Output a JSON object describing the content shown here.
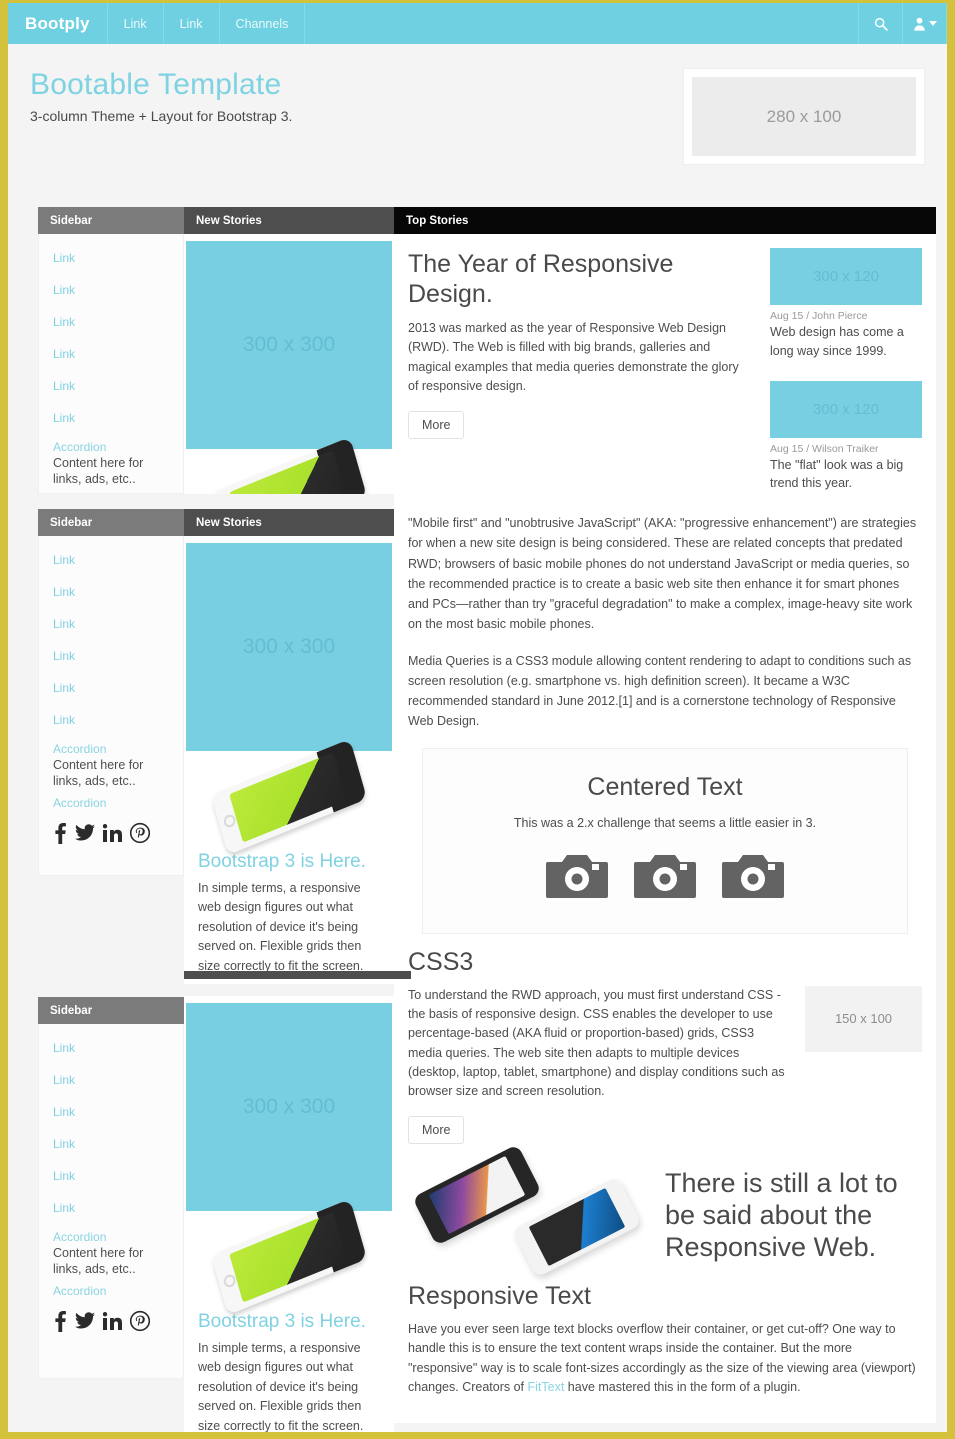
{
  "colors": {
    "brand": "#6ed0e0",
    "frame": "#d4c13c",
    "accent": "#7ed3e3",
    "placeholder_blue": "#79cfe2"
  },
  "navbar": {
    "brand": "Bootply",
    "links": [
      "Link",
      "Link",
      "Channels"
    ],
    "search_icon": "search-icon",
    "user_icon": "user-icon"
  },
  "hero": {
    "title": "Bootable Template",
    "subtitle": "3-column Theme + Layout for Bootstrap 3.",
    "ad_placeholder": "280 x 100"
  },
  "panels": {
    "sidebar_header": "Sidebar",
    "new_stories_header": "New Stories",
    "top_stories_header": "Top Stories"
  },
  "sidebar": {
    "links": [
      "Link",
      "Link",
      "Link",
      "Link",
      "Link",
      "Link"
    ],
    "accordion_title": "Accordion",
    "accordion_body": "Content here for links, ads, etc..",
    "accordion_title2": "Accordion",
    "social": [
      "facebook-icon",
      "twitter-icon",
      "linkedin-icon",
      "pinterest-icon"
    ]
  },
  "new_stories": {
    "image_placeholder": "300 x 300",
    "story_title": "Bootstrap 3 is Here.",
    "story_text": "In simple terms, a responsive web design figures out what resolution of device it's being served on. Flexible grids then size correctly to fit the screen."
  },
  "top_stories": {
    "article_title": "The Year of Responsive Design.",
    "article_text": "2013 was marked as the year of Responsive Web Design (RWD). The Web is filled with big brands, galleries and magical examples that media queries demonstrate the glory of responsive design.",
    "more_label": "More",
    "teasers": [
      {
        "placeholder": "300 x 120",
        "meta": "Aug 15 / John Pierce",
        "text": "Web design has come a long way since 1999."
      },
      {
        "placeholder": "300 x 120",
        "meta": "Aug 15 / Wilson Traiker",
        "text": "The \"flat\" look was a big trend this year."
      }
    ],
    "paragraphs": [
      "\"Mobile first\" and \"unobtrusive JavaScript\" (AKA: \"progressive enhancement\") are strategies for when a new site design is being considered. These are related concepts that predated RWD; browsers of basic mobile phones do not understand JavaScript or media queries, so the recommended practice is to create a basic web site then enhance it for smart phones and PCs—rather than try \"graceful degradation\" to make a complex, image-heavy site work on the most basic mobile phones.",
      "Media Queries is a CSS3 module allowing content rendering to adapt to conditions such as screen resolution (e.g. smartphone vs. high definition screen). It became a W3C recommended standard in June 2012.[1] and is a cornerstone technology of Responsive Web Design."
    ],
    "well": {
      "heading": "Centered Text",
      "text": "This was a 2.x challenge that seems a little easier in 3.",
      "icons": [
        "camera-icon",
        "camera-icon",
        "camera-icon"
      ]
    },
    "css3": {
      "heading": "CSS3",
      "text": "To understand the RWD approach, you must first understand CSS - the basis of responsive design. CSS enables the developer to use percentage-based (AKA fluid or proportion-based) grids, CSS3 media queries. The web site then adapts to multiple devices (desktop, laptop, tablet, smartphone) and display conditions such as browser size and screen resolution.",
      "placeholder": "150 x 100",
      "more_label": "More"
    },
    "claim": "There is still a lot to be said about the Responsive Web.",
    "responsive_text": {
      "heading": "Responsive Text",
      "text_before": "Have you ever seen large text blocks overflow their container, or get cut-off? One way to handle this is to ensure the text content wraps inside the container. But the more \"responsive\" way is to scale font-sizes accordingly as the size of the viewing area (viewport) changes. Creators of ",
      "link": "FitText",
      "text_after": " have mastered this in the form of a plugin."
    }
  }
}
